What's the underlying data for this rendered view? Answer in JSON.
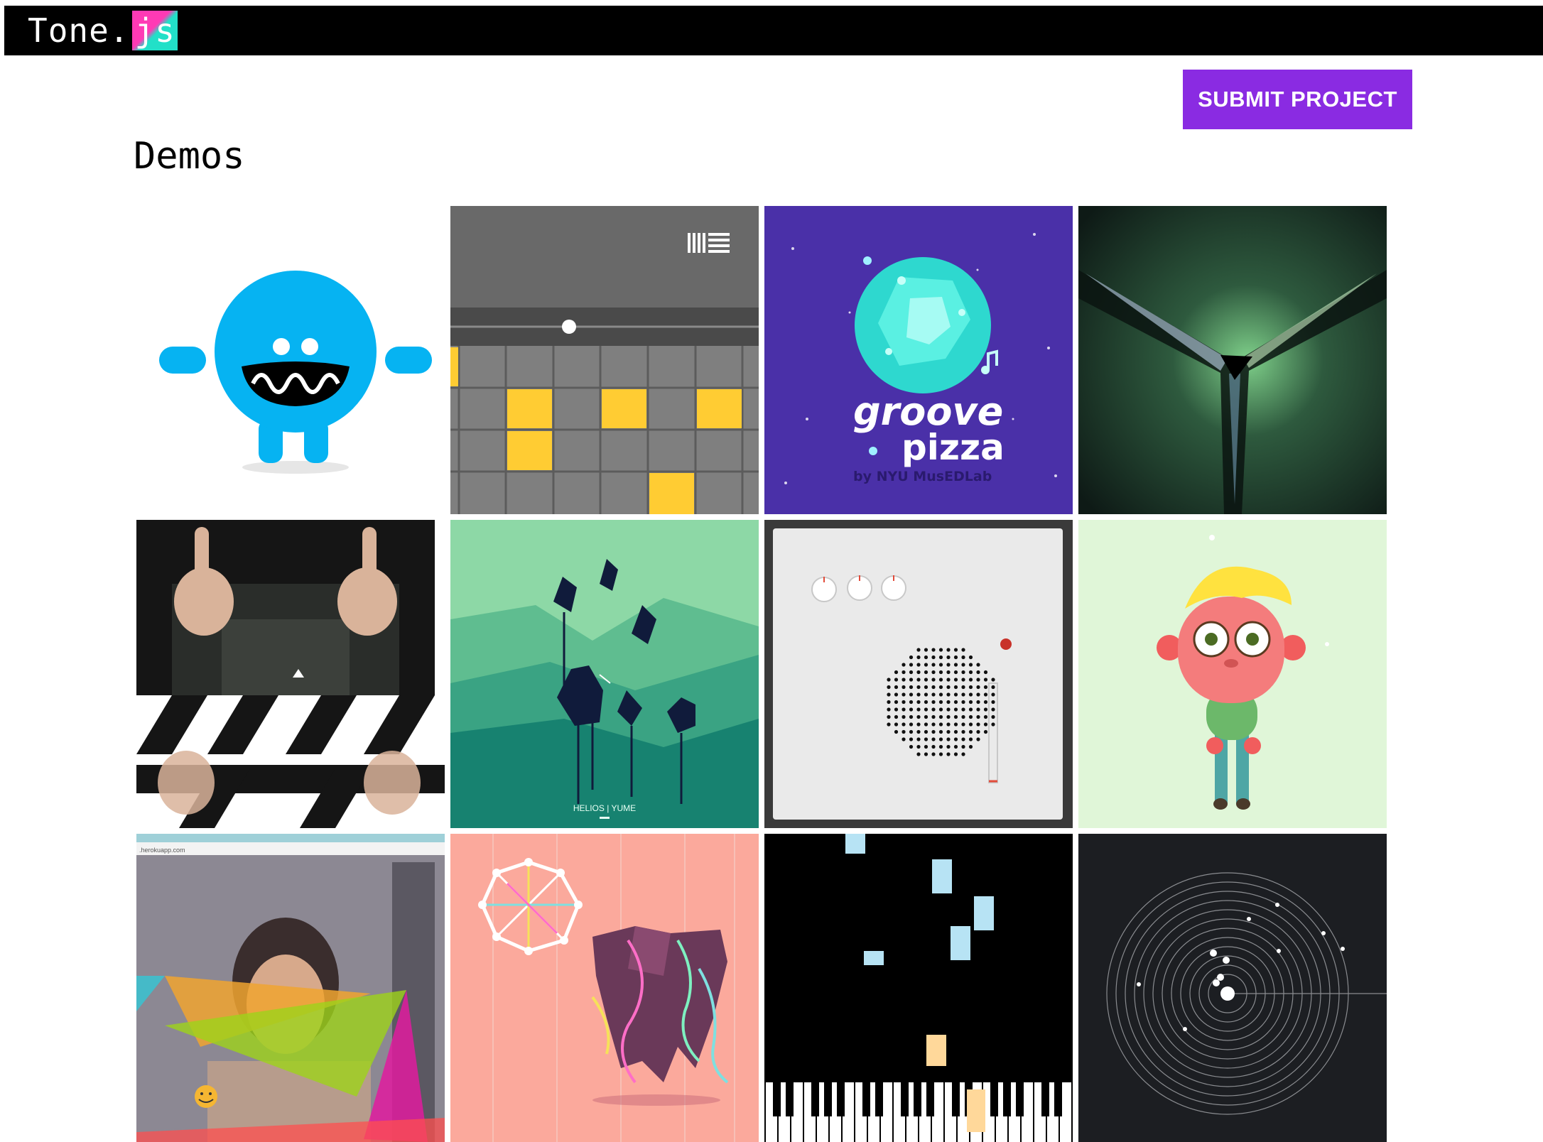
{
  "header": {
    "logo_text": "Tone.",
    "logo_suffix": "js"
  },
  "actions": {
    "submit_label": "SUBMIT PROJECT"
  },
  "page": {
    "title": "Demos"
  },
  "demos": [
    {
      "icon": "blue-monster-thumbnail"
    },
    {
      "icon": "step-sequencer-thumbnail"
    },
    {
      "icon": "groove-pizza-thumbnail",
      "title_line1": "groove",
      "title_line2": "pizza",
      "byline": "by NYU MusEDLab"
    },
    {
      "icon": "prism-light-thumbnail"
    },
    {
      "icon": "thumbs-up-thumbnail"
    },
    {
      "icon": "helios-yume-thumbnail",
      "caption": "HELIOS | YUME"
    },
    {
      "icon": "radio-speaker-thumbnail"
    },
    {
      "icon": "cartoon-character-thumbnail"
    },
    {
      "icon": "webcam-triangles-thumbnail",
      "url_text": ".herokuapp.com"
    },
    {
      "icon": "geometric-creature-thumbnail"
    },
    {
      "icon": "piano-falling-notes-thumbnail"
    },
    {
      "icon": "orbit-circles-thumbnail"
    }
  ],
  "colors": {
    "accent": "#8a2be2",
    "topbar": "#000000"
  }
}
